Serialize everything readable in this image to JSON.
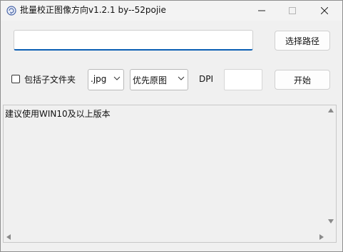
{
  "window": {
    "title": "批量校正图像方向v1.2.1  by--52pojie"
  },
  "toolbar": {
    "path_value": "",
    "browse_label": "选择路径",
    "include_subfolders_label": "包括子文件夹",
    "include_subfolders_checked": false,
    "extension_selected": ".jpg",
    "mode_selected": "优先原图",
    "dpi_label": "DPI",
    "dpi_value": "",
    "start_label": "开始"
  },
  "log": {
    "text": "建议使用WIN10及以上版本"
  },
  "icons": {
    "app": "app-icon",
    "minimize": "minimize-icon",
    "maximize": "maximize-icon",
    "close": "close-icon"
  }
}
